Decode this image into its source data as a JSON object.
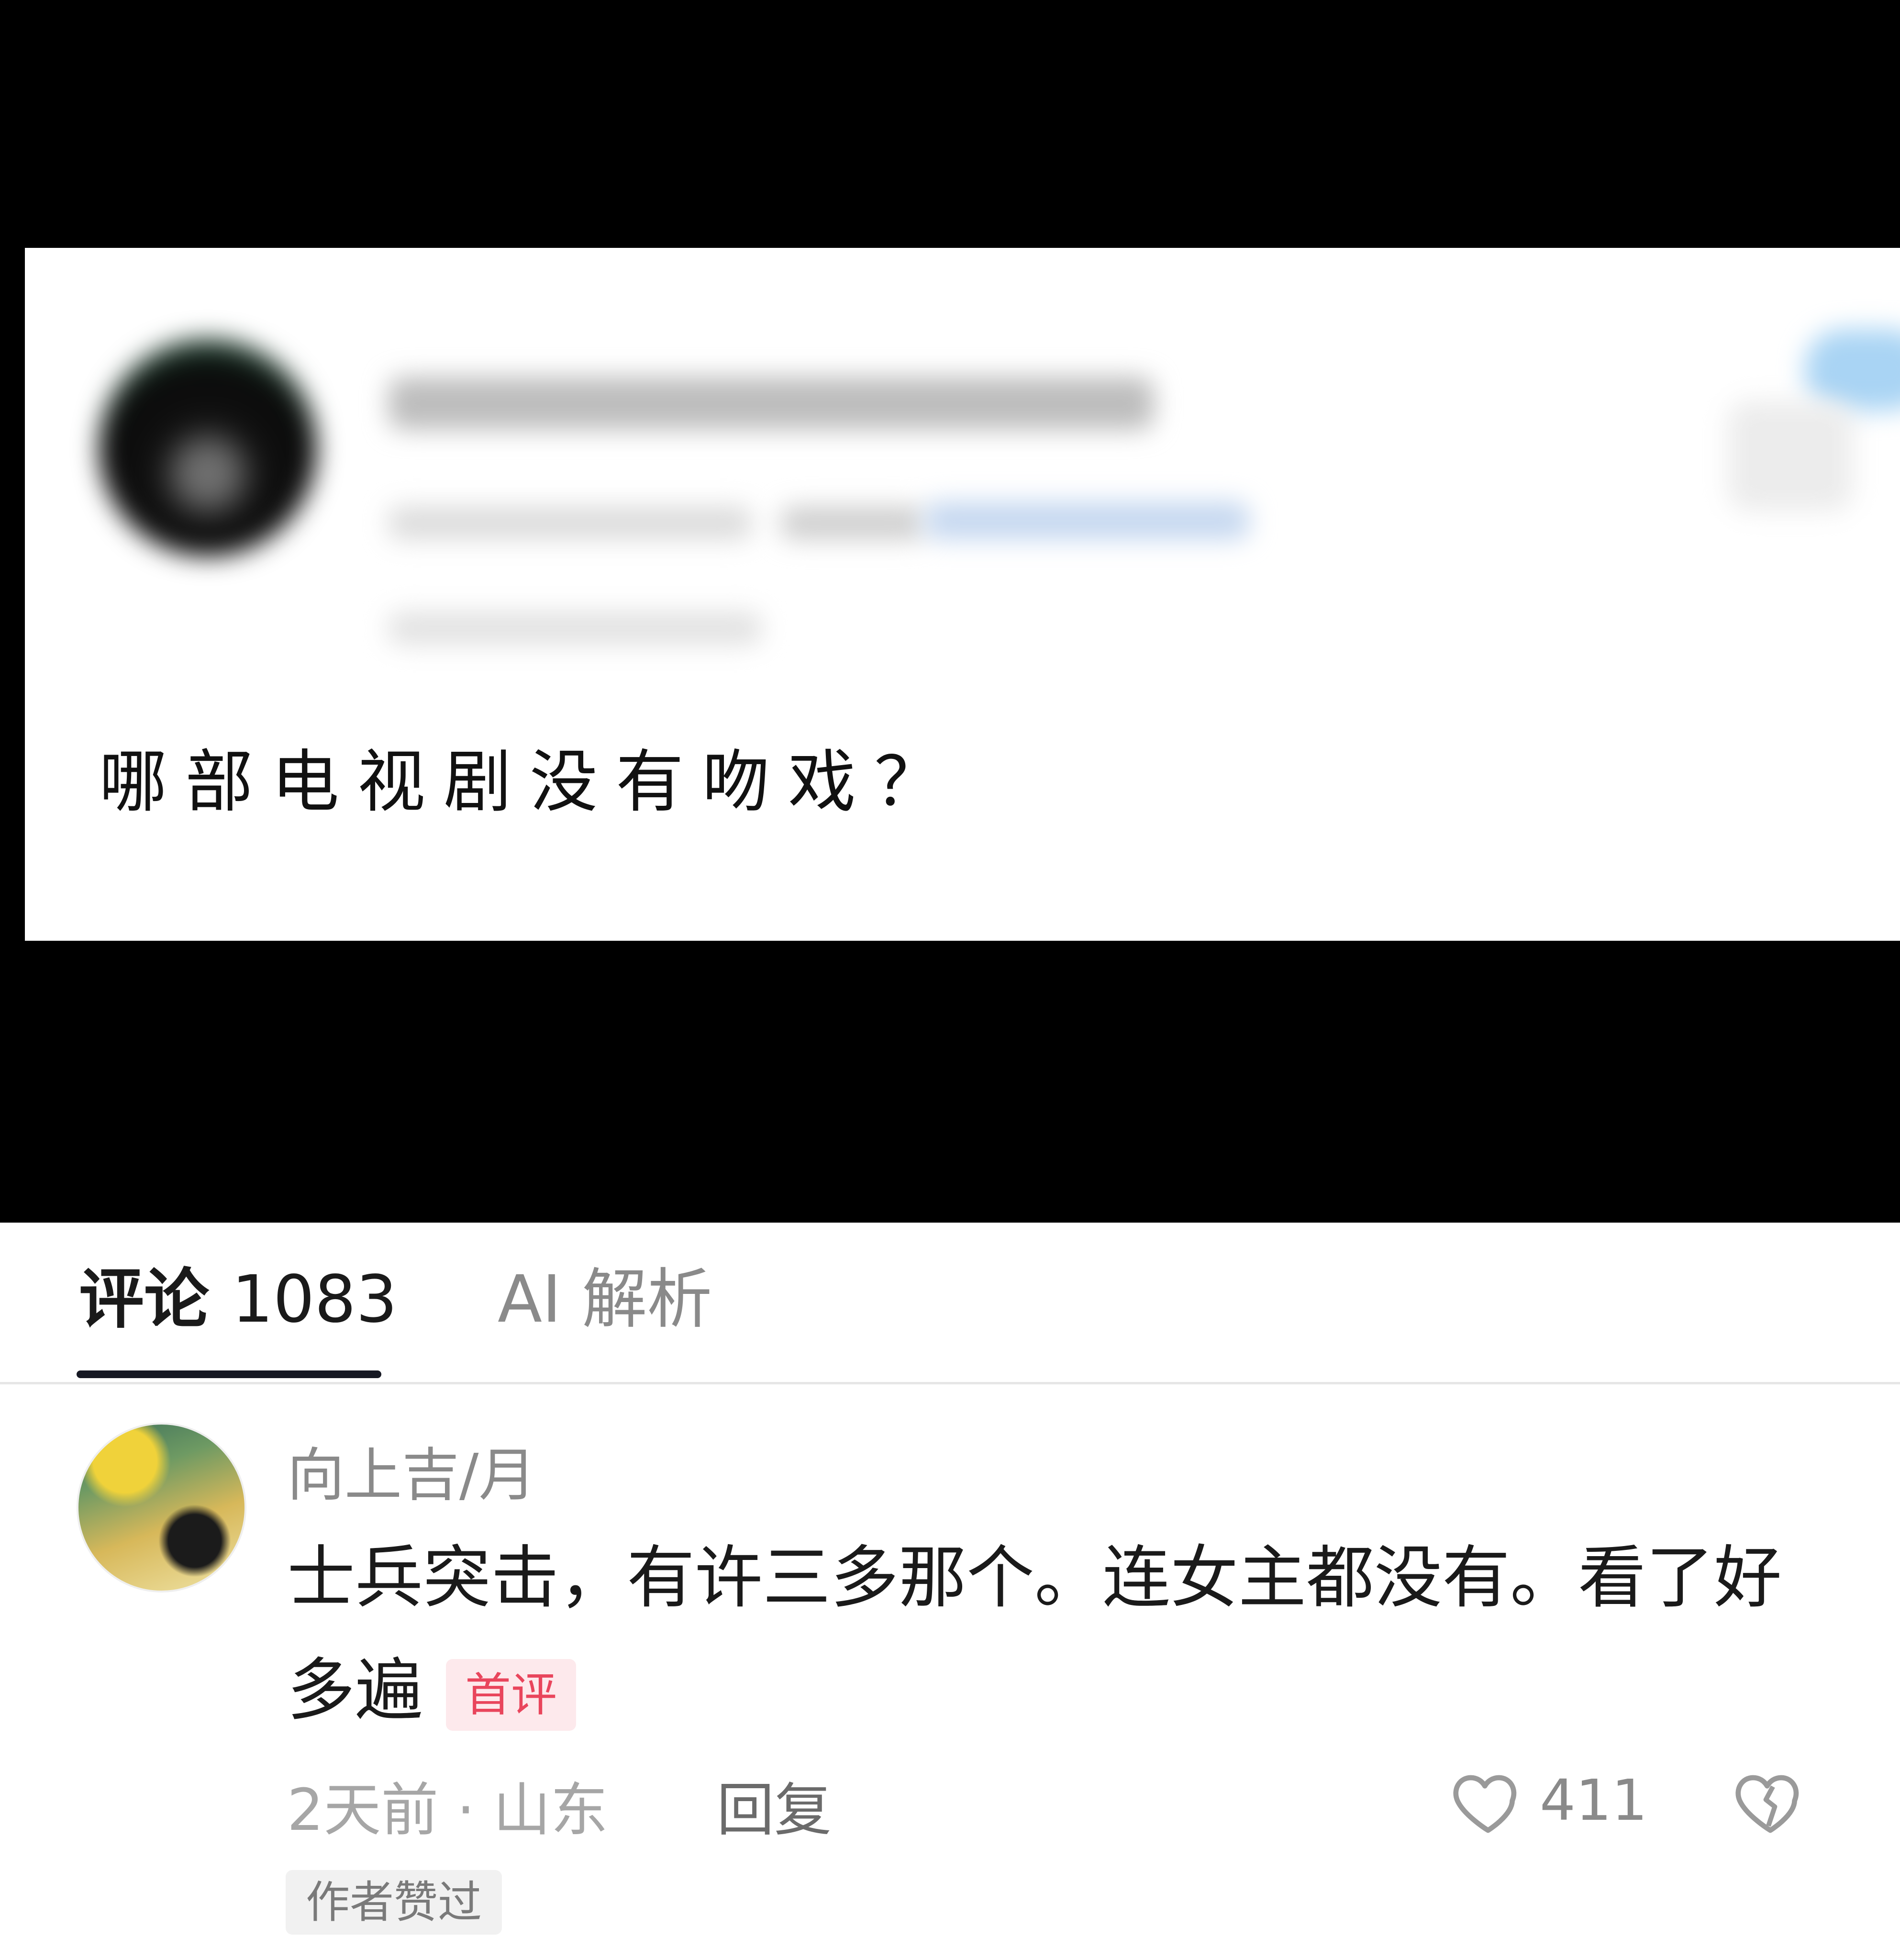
{
  "post": {
    "question_text": "哪部电视剧没有吻戏？"
  },
  "tabs": {
    "comments_label": "评论",
    "comments_count": "1083",
    "ai_label": "AI 解析"
  },
  "comment": {
    "username": "向上吉/月",
    "text": "士兵突击，有许三多那个。连女主都没有。看了好多遍",
    "badge": "首评",
    "time_location": "2天前 · 山东",
    "reply_label": "回复",
    "like_count": "411",
    "author_liked_label": "作者赞过"
  },
  "icons": {
    "like": "heart-outline-icon",
    "dislike": "broken-heart-icon"
  },
  "colors": {
    "badge_text": "#e9455c",
    "badge_bg": "#fde9ec",
    "tab_underline": "#161823"
  }
}
